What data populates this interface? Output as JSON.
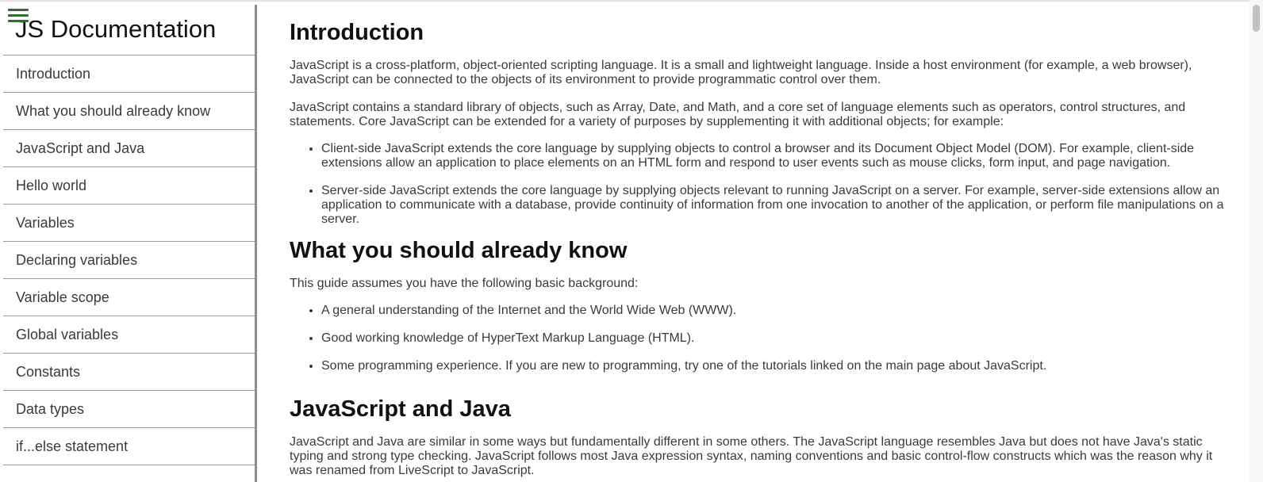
{
  "sidebar": {
    "title": "JS Documentation",
    "items": [
      {
        "label": "Introduction"
      },
      {
        "label": "What you should already know"
      },
      {
        "label": "JavaScript and Java"
      },
      {
        "label": "Hello world"
      },
      {
        "label": "Variables"
      },
      {
        "label": "Declaring variables"
      },
      {
        "label": "Variable scope"
      },
      {
        "label": "Global variables"
      },
      {
        "label": "Constants"
      },
      {
        "label": "Data types"
      },
      {
        "label": "if...else statement"
      }
    ]
  },
  "menu_icon": "hamburger-icon",
  "main": {
    "introduction": {
      "heading": "Introduction",
      "p1": "JavaScript is a cross-platform, object-oriented scripting language. It is a small and lightweight language. Inside a host environment (for example, a web browser), JavaScript can be connected to the objects of its environment to provide programmatic control over them.",
      "p2": "JavaScript contains a standard library of objects, such as Array, Date, and Math, and a core set of language elements such as operators, control structures, and statements. Core JavaScript can be extended for a variety of purposes by supplementing it with additional objects; for example:",
      "bullets": [
        "Client-side JavaScript extends the core language by supplying objects to control a browser and its Document Object Model (DOM). For example, client-side extensions allow an application to place elements on an HTML form and respond to user events such as mouse clicks, form input, and page navigation.",
        "Server-side JavaScript extends the core language by supplying objects relevant to running JavaScript on a server. For example, server-side extensions allow an application to communicate with a database, provide continuity of information from one invocation to another of the application, or perform file manipulations on a server."
      ]
    },
    "know": {
      "heading": "What you should already know",
      "p1": "This guide assumes you have the following basic background:",
      "bullets": [
        "A general understanding of the Internet and the World Wide Web (WWW).",
        "Good working knowledge of HyperText Markup Language (HTML).",
        "Some programming experience. If you are new to programming, try one of the tutorials linked on the main page about JavaScript."
      ]
    },
    "java": {
      "heading": "JavaScript and Java",
      "p1": "JavaScript and Java are similar in some ways but fundamentally different in some others. The JavaScript language resembles Java but does not have Java's static typing and strong type checking. JavaScript follows most Java expression syntax, naming conventions and basic control-flow constructs which was the reason why it was renamed from LiveScript to JavaScript."
    }
  }
}
